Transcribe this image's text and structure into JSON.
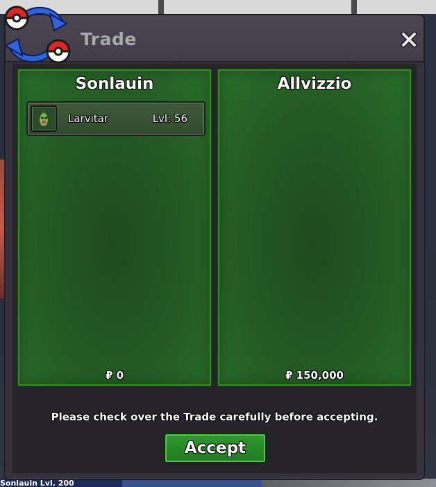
{
  "window": {
    "title": "Trade",
    "logo_icon": "trade-pokeball-swap-icon",
    "close_icon": "close-icon"
  },
  "left_party": {
    "name": "Sonlauin",
    "money": "₽ 0",
    "items": [
      {
        "name": "Larvitar",
        "level": "Lvl: 56",
        "icon": "larvitar-sprite-icon"
      }
    ]
  },
  "right_party": {
    "name": "Allvizzio",
    "money": "₽ 150,000",
    "items": []
  },
  "notice": "Please check over the Trade carefully before accepting.",
  "accept_label": "Accept",
  "background_hud": {
    "bottom_text": "Sonlauin Lvl. 200"
  },
  "colors": {
    "panel_green": "#235a23",
    "accept_green": "#2e9a2e",
    "window_bg": "#35313c",
    "title_text": "#a8a8ad"
  }
}
